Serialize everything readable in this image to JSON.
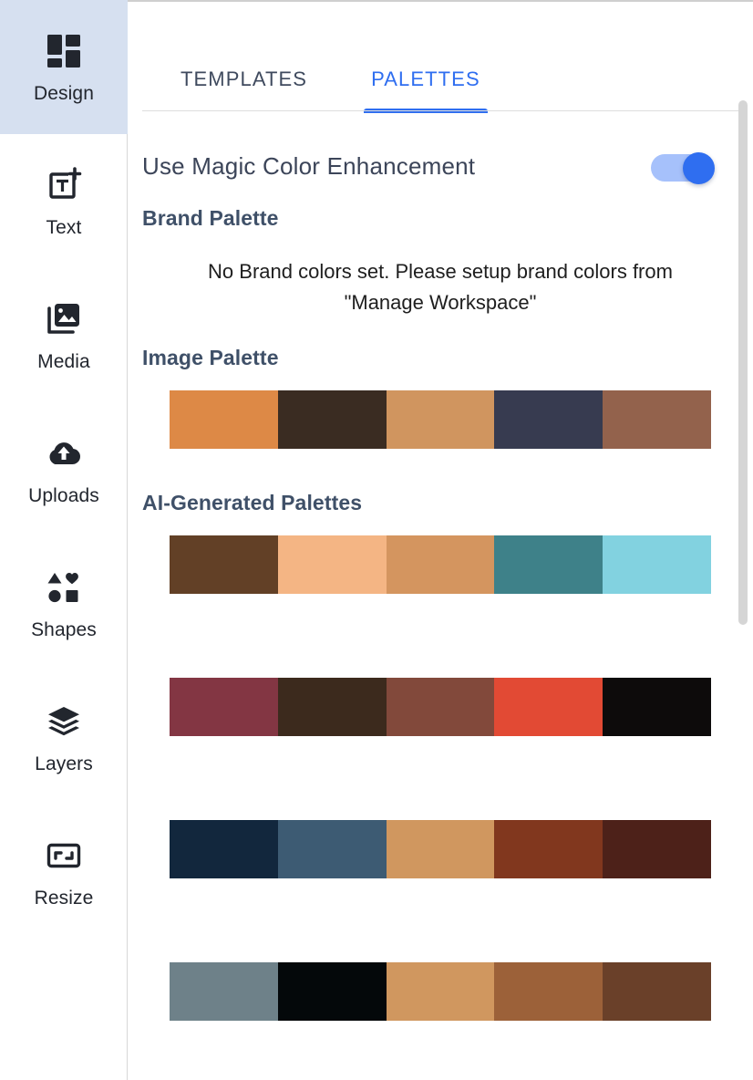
{
  "sidebar": {
    "items": [
      {
        "label": "Design",
        "icon": "grid-blocks-icon",
        "active": true
      },
      {
        "label": "Text",
        "icon": "text-box-plus-icon",
        "active": false
      },
      {
        "label": "Media",
        "icon": "image-stack-icon",
        "active": false
      },
      {
        "label": "Uploads",
        "icon": "cloud-upload-icon",
        "active": false
      },
      {
        "label": "Shapes",
        "icon": "shapes-icon",
        "active": false
      },
      {
        "label": "Layers",
        "icon": "layers-icon",
        "active": false
      },
      {
        "label": "Resize",
        "icon": "resize-frame-icon",
        "active": false
      }
    ]
  },
  "tabs": [
    {
      "label": "TEMPLATES",
      "active": false
    },
    {
      "label": "PALETTES",
      "active": true
    }
  ],
  "magic_color": {
    "label": "Use Magic Color Enhancement",
    "enabled": true,
    "track_color": "#a6c1fb",
    "thumb_color": "#2f6ef0"
  },
  "sections": {
    "brand": {
      "title": "Brand Palette",
      "empty_message": "No Brand colors set. Please setup brand colors from \"Manage Workspace\""
    },
    "image": {
      "title": "Image Palette",
      "palettes": [
        [
          "#dd8946",
          "#3a2c22",
          "#d0955f",
          "#373b50",
          "#93624c"
        ]
      ]
    },
    "ai": {
      "title": "AI-Generated Palettes",
      "palettes": [
        [
          "#624026",
          "#f4b584",
          "#d4955f",
          "#3e8189",
          "#82d2e0"
        ],
        [
          "#833643",
          "#3c2a1d",
          "#82493b",
          "#e24a34",
          "#0d0b0b"
        ],
        [
          "#12273d",
          "#3d5b73",
          "#d0975f",
          "#81371e",
          "#4d2119"
        ],
        [
          "#6e8189",
          "#04080a",
          "#d0975f",
          "#9c6139",
          "#6a4029"
        ]
      ]
    }
  },
  "accent_color": "#2f6ef0",
  "active_sidebar_bg": "#d6e0f0"
}
